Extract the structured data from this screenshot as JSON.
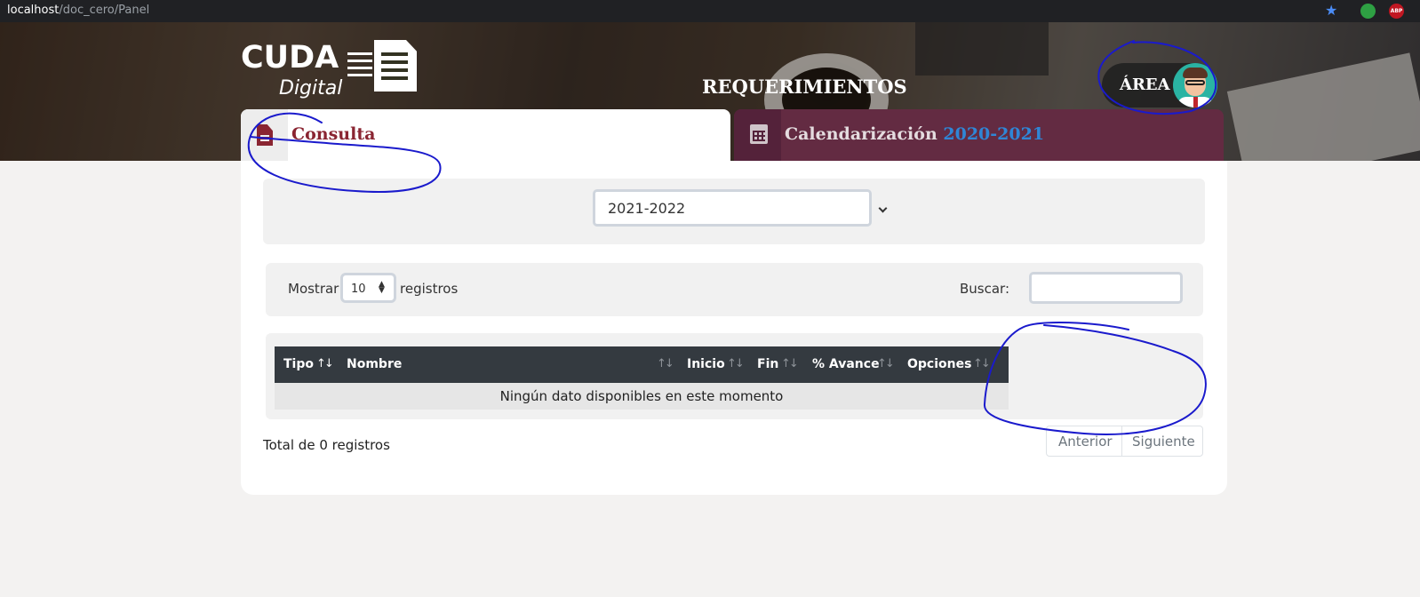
{
  "browser": {
    "url_host": "localhost",
    "url_path": "/doc_cero/Panel",
    "bookmark_icon": "star-icon",
    "extension_abp_label": "ABP"
  },
  "header": {
    "logo_line1": "CUDA",
    "logo_line2": "Digital",
    "title": "REQUERIMIENTOS",
    "user_label": "ÁREA"
  },
  "tabs": {
    "consulta": {
      "label": "Consulta",
      "icon": "file-icon",
      "active": true
    },
    "calendarizacion": {
      "label": "Calendarización",
      "year": "2020-2021",
      "icon": "calendar-icon",
      "active": false
    }
  },
  "year_filter": {
    "selected": "2021-2022",
    "options": [
      "2021-2022"
    ]
  },
  "table_controls": {
    "show_label": "Mostrar",
    "page_length": "10",
    "records_label": "registros",
    "search_label": "Buscar:",
    "search_value": ""
  },
  "table": {
    "columns": [
      "Tipo",
      "Nombre",
      "Inicio",
      "Fin",
      "% Avance",
      "Opciones"
    ],
    "empty_message": "Ningún dato disponibles en este momento",
    "rows": []
  },
  "footer": {
    "total_text": "Total de 0 registros",
    "prev_label": "Anterior",
    "next_label": "Siguiente"
  },
  "colors": {
    "accent_maroon": "#8a2532",
    "tab_inactive_bg": "#632b42",
    "year_highlight": "#2f86d6",
    "table_header_bg": "#343a40",
    "annotation_ink": "#1a1acc"
  }
}
